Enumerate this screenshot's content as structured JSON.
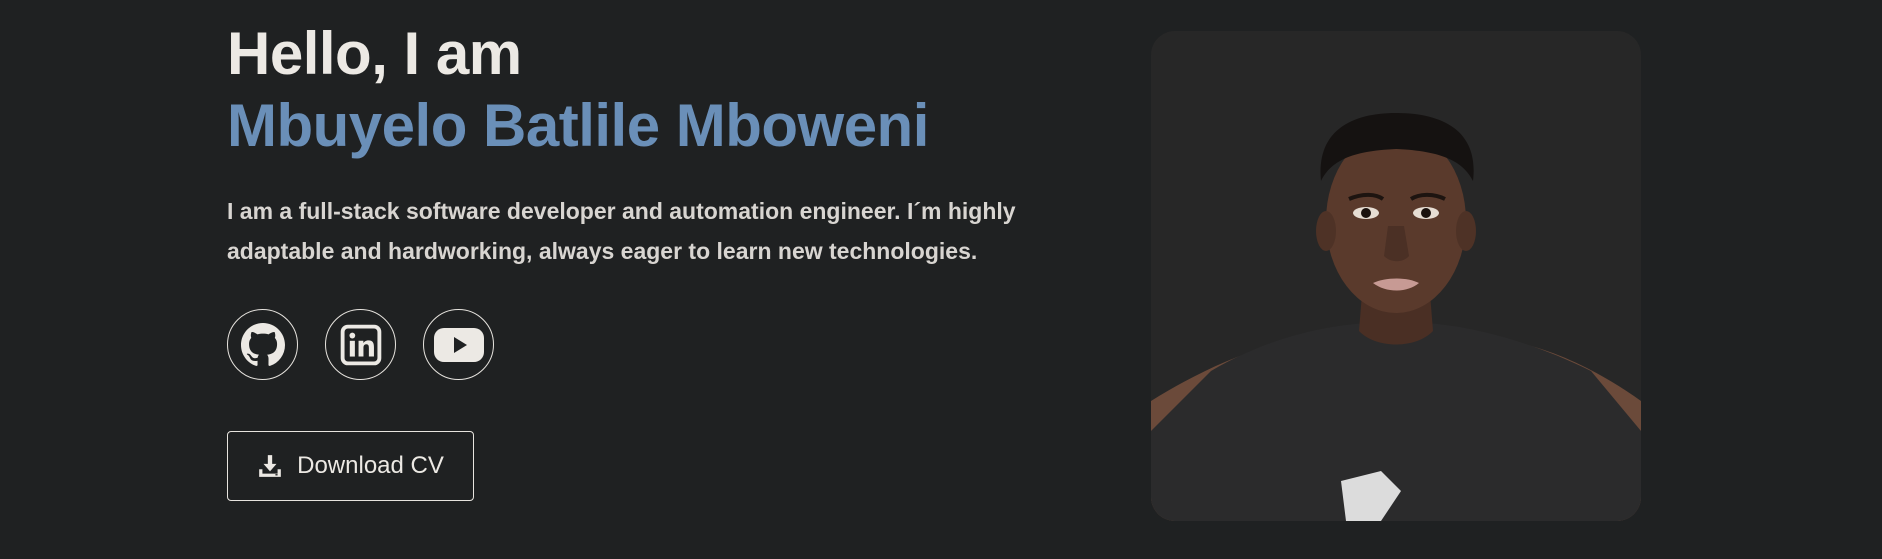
{
  "hero": {
    "greeting": "Hello, I am",
    "name": "Mbuyelo Batlile Mboweni",
    "bio": "I am a full-stack software developer and automation engineer. I´m highly adaptable and hardworking, always eager to learn new technologies.",
    "socials": [
      {
        "name": "github",
        "icon": "github-icon"
      },
      {
        "name": "linkedin",
        "icon": "linkedin-icon"
      },
      {
        "name": "youtube",
        "icon": "youtube-icon"
      }
    ],
    "download_button": {
      "label": "Download CV",
      "icon": "download-icon"
    },
    "photo": {
      "icon": "profile-photo"
    }
  },
  "colors": {
    "background": "#1f2122",
    "heading": "#ece9e4",
    "accent": "#6a8fb8",
    "body_text": "#d8d5d1",
    "photo_background": "#272727"
  }
}
